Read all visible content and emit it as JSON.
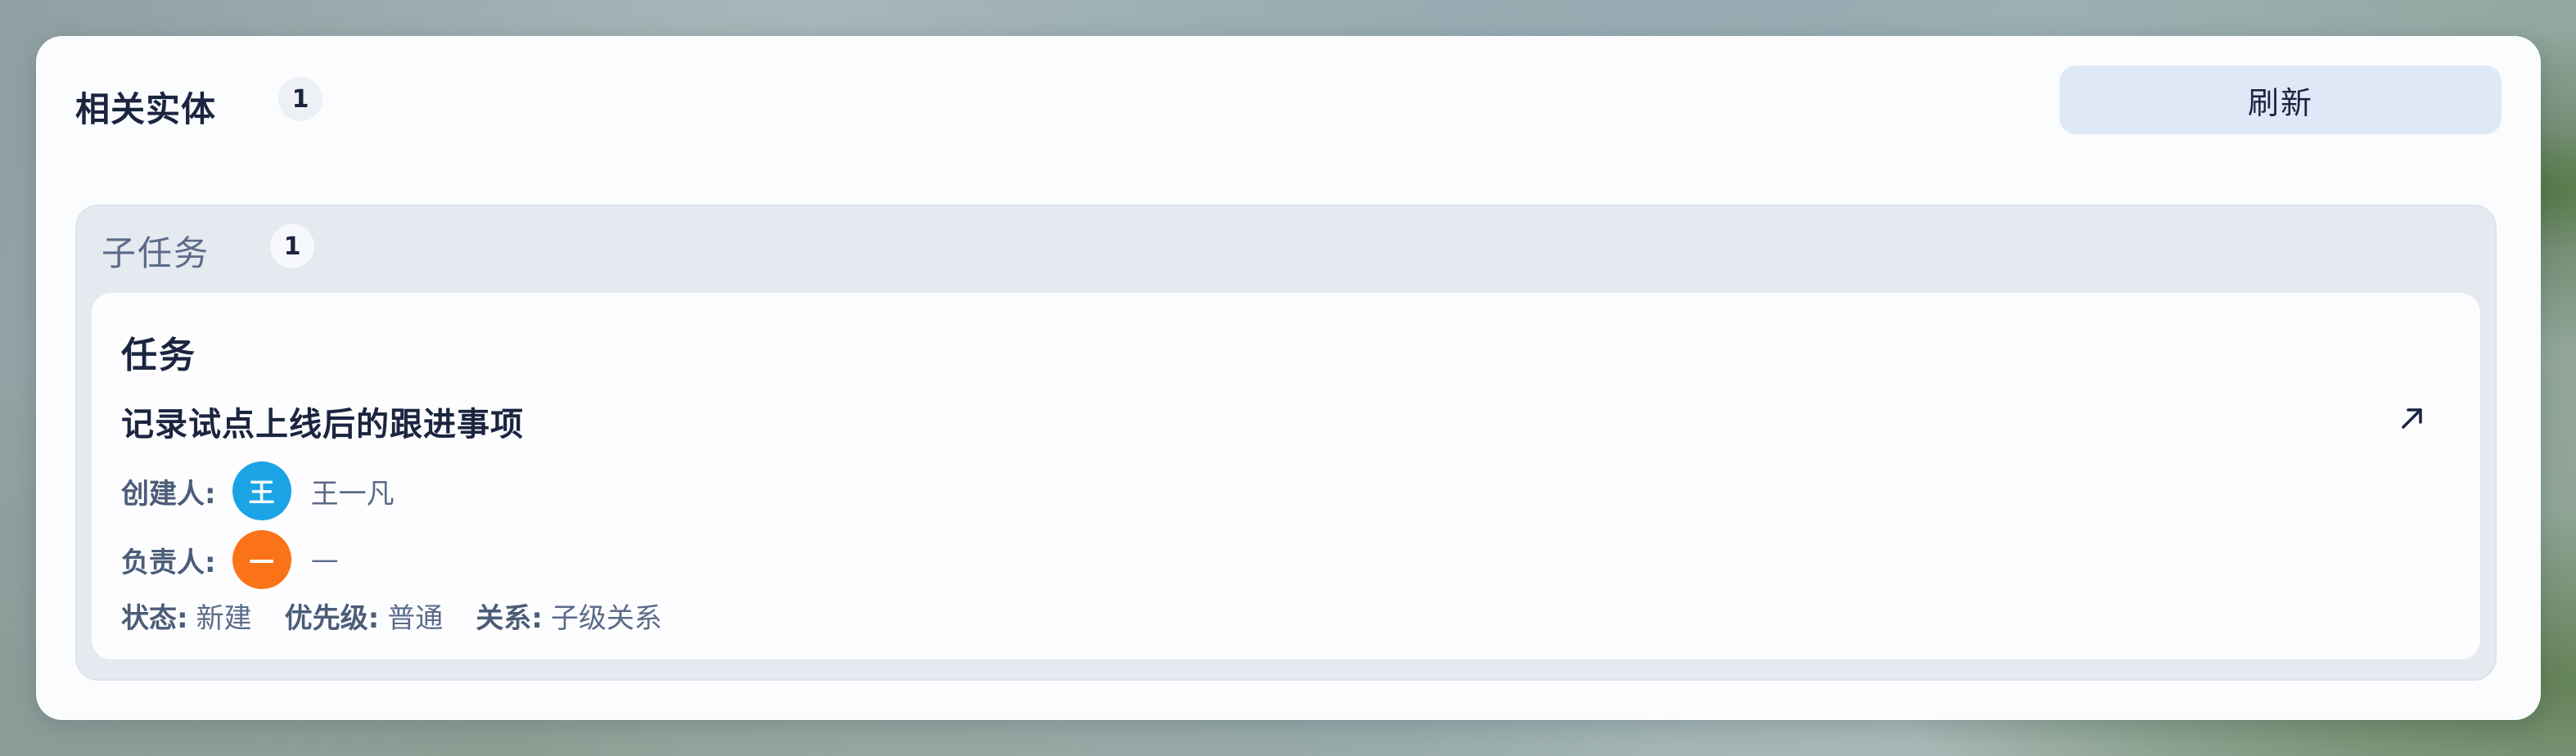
{
  "panel": {
    "title": "相关实体",
    "count": "1",
    "refresh_label": "刷新"
  },
  "group": {
    "title": "子任务",
    "count": "1"
  },
  "item": {
    "type": "任务",
    "title": "记录试点上线后的跟进事项",
    "open_icon": "arrow-up-right-icon",
    "creator_label": "创建人:",
    "creator_avatar": "王",
    "creator_avatar_color": "#1aa4e6",
    "creator_name": "王一凡",
    "assignee_label": "负责人:",
    "assignee_avatar": "—",
    "assignee_avatar_color": "#fb7318",
    "assignee_name": "—",
    "status_label": "状态:",
    "status_value": "新建",
    "priority_label": "优先级:",
    "priority_value": "普通",
    "relation_label": "关系:",
    "relation_value": "子级关系"
  }
}
